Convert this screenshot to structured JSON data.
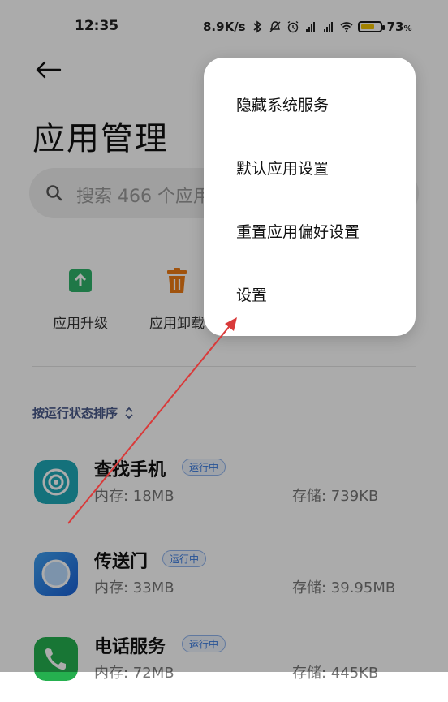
{
  "status_bar": {
    "time": "12:35",
    "network_speed": "8.9K/s",
    "battery_percent": "73",
    "battery_unit": "%",
    "battery_level": 0.73
  },
  "header": {
    "title": "应用管理"
  },
  "search": {
    "placeholder": "搜索 466 个应用"
  },
  "quick_actions": [
    {
      "label": "应用升级",
      "icon": "upgrade-icon",
      "color": "#2fb36b"
    },
    {
      "label": "应用卸载",
      "icon": "trash-icon",
      "color": "#ef7d16"
    }
  ],
  "sort": {
    "label": "按运行状态排序"
  },
  "apps": [
    {
      "name": "查找手机",
      "badge": "运行中",
      "memory": "内存: 18MB",
      "storage": "存储: 739KB",
      "icon": "find-phone-icon"
    },
    {
      "name": "传送门",
      "badge": "运行中",
      "memory": "内存: 33MB",
      "storage": "存储: 39.95MB",
      "icon": "portal-icon"
    },
    {
      "name": "电话服务",
      "badge": "运行中",
      "memory": "内存: 72MB",
      "storage": "存储: 445KB",
      "icon": "phone-icon"
    }
  ],
  "menu": {
    "items": [
      {
        "label": "隐藏系统服务"
      },
      {
        "label": "默认应用设置"
      },
      {
        "label": "重置应用偏好设置"
      },
      {
        "label": "设置"
      }
    ]
  },
  "colors": {
    "badge_blue": "#3a7be0",
    "annotation_red": "#d93a3a",
    "battery_yellow": "#f2c200"
  }
}
